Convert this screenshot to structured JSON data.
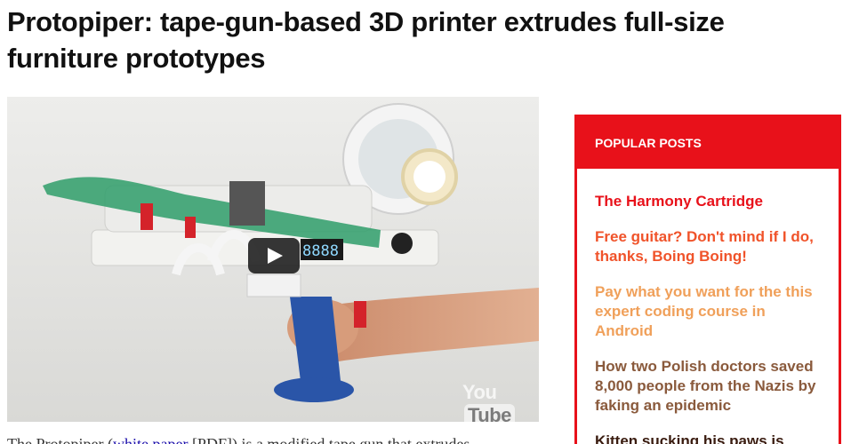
{
  "article": {
    "title": "Protopiper: tape-gun-based 3D printer extrudes full-size furniture prototypes",
    "body_start": "The Protopiper (",
    "body_link": "white paper",
    "body_rest": " [PDF]) is a modified tape gun that extrudes"
  },
  "video": {
    "logo_you": "You",
    "logo_tube": "Tube",
    "play_icon": "play-icon",
    "display_text": "8888"
  },
  "sidebar": {
    "popular_posts": {
      "title": "Popular Posts",
      "items": [
        {
          "label": "The Harmony Cartridge",
          "color": "#e8111a"
        },
        {
          "label": "Free guitar? Don't mind if I do, thanks, Boing Boing!",
          "color": "#f0532a"
        },
        {
          "label": "Pay what you want for the this expert coding course in Android",
          "color": "#f0a05a"
        },
        {
          "label": "How two Polish doctors saved 8,000 people from the Nazis by faking an epidemic",
          "color": "#8a5a3c"
        },
        {
          "label": "Kitten sucking his paws is",
          "color": "#3a1c10"
        }
      ]
    }
  },
  "colors": {
    "accent": "#e8111a",
    "headline": "#111111",
    "link": "#1a0dab"
  }
}
